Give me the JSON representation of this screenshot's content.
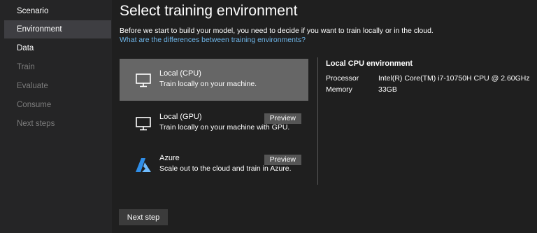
{
  "sidebar": {
    "items": [
      {
        "label": "Scenario"
      },
      {
        "label": "Environment"
      },
      {
        "label": "Data"
      },
      {
        "label": "Train"
      },
      {
        "label": "Evaluate"
      },
      {
        "label": "Consume"
      },
      {
        "label": "Next steps"
      }
    ]
  },
  "main": {
    "title": "Select training environment",
    "description": "Before we start to build your model, you need to decide if you want to train locally or in the cloud.",
    "link": "What are the differences between training environments?",
    "options": [
      {
        "name": "Local (CPU)",
        "subtitle": "Train locally on your machine.",
        "icon": "monitor-icon"
      },
      {
        "name": "Local (GPU)",
        "subtitle": "Train locally on your machine with GPU.",
        "badge": "Preview",
        "icon": "monitor-icon"
      },
      {
        "name": "Azure",
        "subtitle": "Scale out to the cloud and train in Azure.",
        "badge": "Preview",
        "icon": "azure-icon"
      }
    ],
    "next_button": "Next step"
  },
  "details": {
    "title": "Local CPU environment",
    "rows": [
      {
        "label": "Processor",
        "value": "Intel(R) Core(TM) i7-10750H CPU @ 2.60GHz"
      },
      {
        "label": "Memory",
        "value": "33GB"
      }
    ]
  },
  "colors": {
    "accent_link": "#6eb5e8",
    "selected_bg": "#666666",
    "sidebar_active": "#3e3e42",
    "azure_blue": "#2f8ee8"
  }
}
